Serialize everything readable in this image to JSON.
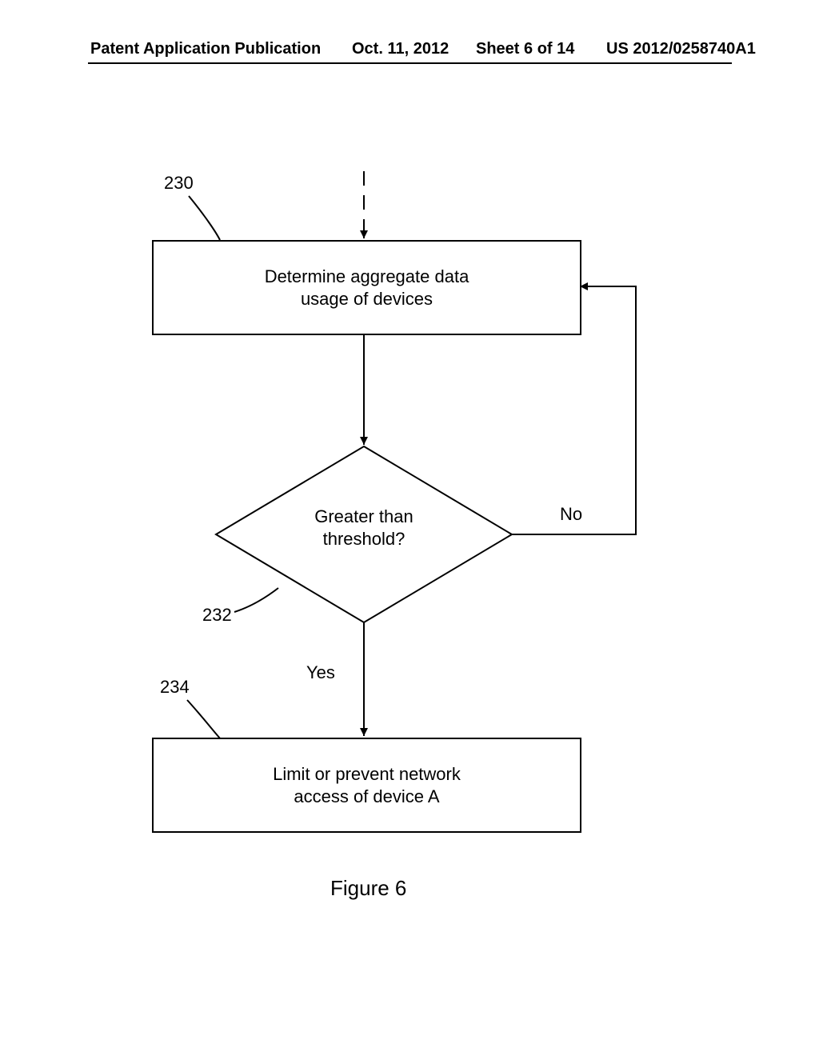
{
  "header": {
    "publication_type": "Patent Application Publication",
    "date": "Oct. 11, 2012",
    "sheet": "Sheet 6 of 14",
    "number": "US 2012/0258740A1"
  },
  "flow": {
    "step_230": {
      "ref": "230",
      "line1": "Determine aggregate data",
      "line2": "usage of devices"
    },
    "decision_232": {
      "ref": "232",
      "line1": "Greater than",
      "line2": "threshold?",
      "branch_no": "No",
      "branch_yes": "Yes"
    },
    "step_234": {
      "ref": "234",
      "line1": "Limit or prevent network",
      "line2": "access of device A"
    }
  },
  "figure_caption": "Figure 6"
}
